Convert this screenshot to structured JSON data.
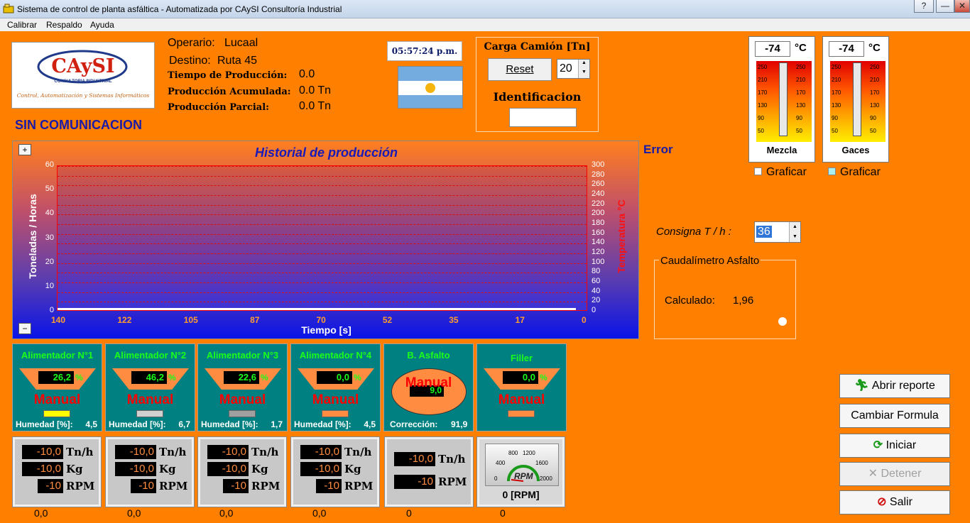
{
  "window": {
    "title": "Sistema de control de planta asfáltica - Automatizada por CAySI Consultoría Industrial",
    "buttons": [
      "?",
      "—",
      "✕"
    ]
  },
  "menu": [
    "Calibrar",
    "Respaldo",
    "Ayuda"
  ],
  "logo": {
    "brand": "CAySI",
    "sub": "CONSULTORIA INDUSTRIAL",
    "tagline": "Control, Automatización y Sistemas Informáticos"
  },
  "status": "SIN COMUNICACION",
  "info": {
    "operario_label": "Operario:",
    "operario": "Lucaal",
    "destino_label": "Destino:",
    "destino": "Ruta 45",
    "tiempo_label": "Tiempo de Producción:",
    "tiempo": "0.0",
    "acum_label": "Producción Acumulada:",
    "acum": "0.0 Tn",
    "parcial_label": "Producción Parcial:",
    "parcial": "0.0 Tn"
  },
  "clock": "05:57:24 p.m.",
  "carga": {
    "title": "Carga Camión [Tn]",
    "reset": "Reset",
    "value": "20",
    "ident_label": "Identificacion",
    "ident_value": ""
  },
  "chart_data": {
    "type": "line",
    "title": "Historial de producción",
    "xlabel": "Tiempo [s]",
    "ylabel": "Toneladas / Horas",
    "y2label": "Temperatura °C",
    "x_ticks": [
      "140",
      "122",
      "105",
      "87",
      "70",
      "52",
      "35",
      "17",
      "0"
    ],
    "y_ticks": [
      "60",
      "50",
      "40",
      "30",
      "20",
      "10",
      "0"
    ],
    "y2_ticks": [
      "300",
      "280",
      "260",
      "240",
      "220",
      "200",
      "180",
      "160",
      "140",
      "120",
      "100",
      "80",
      "60",
      "40",
      "20",
      "0"
    ],
    "ylim": [
      0,
      60
    ],
    "y2lim": [
      0,
      300
    ],
    "grid": true,
    "series": []
  },
  "chart_zoom": {
    "plus": "+",
    "minus": "−"
  },
  "error": "Error",
  "thermo": [
    {
      "value": "-74",
      "unit": "°C",
      "label": "Mezcla",
      "graf": "Graficar",
      "check_color": "#ffffff"
    },
    {
      "value": "-74",
      "unit": "°C",
      "label": "Gaces",
      "graf": "Graficar",
      "check_color": "#aaf0f0"
    }
  ],
  "thermo_scale": [
    "250",
    "210",
    "170",
    "130",
    "90",
    "50"
  ],
  "consigna": {
    "label": "Consigna T / h :",
    "value": "36"
  },
  "caudal": {
    "title": "Caudalímetro Asfalto",
    "calc_label": "Calculado:",
    "calc_value": "1,96"
  },
  "feeders": [
    {
      "name": "Alimentador N°1",
      "value": "26,2",
      "pct": "%",
      "mode": "Manual",
      "hum_label": "Humedad [%]:",
      "hum": "4,5",
      "bar": "#ffff00",
      "read": [
        "-10,0",
        "-10,0",
        "-10"
      ],
      "bottom": "0,0"
    },
    {
      "name": "Alimentador N°2",
      "value": "46,2",
      "pct": "%",
      "mode": "Manual",
      "hum_label": "Humedad [%]:",
      "hum": "6,7",
      "bar": "#d0d0d0",
      "read": [
        "-10,0",
        "-10,0",
        "-10"
      ],
      "bottom": "0,0"
    },
    {
      "name": "Alimentador N°3",
      "value": "22,6",
      "pct": "%",
      "mode": "Manual",
      "hum_label": "Humedad [%]:",
      "hum": "1,7",
      "bar": "#a0a0a0",
      "read": [
        "-10,0",
        "-10,0",
        "-10"
      ],
      "bottom": "0,0"
    },
    {
      "name": "Alimentador N°4",
      "value": "0,0",
      "pct": "%",
      "mode": "Manual",
      "hum_label": "Humedad [%]:",
      "hum": "4,5",
      "bar": "#ff8c40",
      "read": [
        "-10,0",
        "-10,0",
        "-10"
      ],
      "bottom": "0,0"
    }
  ],
  "asfalto": {
    "name": "B. Asfalto",
    "value": "9,0",
    "mode": "Manual",
    "corr_label": "Corrección:",
    "corr": "91,9",
    "read": [
      "-10,0",
      "-10"
    ],
    "bottom": "0"
  },
  "filler": {
    "name": "Filler",
    "value": "0,0",
    "pct": "%",
    "mode": "Manual",
    "bar": "#ff8c40",
    "rpm": "0 [RPM]",
    "bottom": "0",
    "gauge": [
      "800",
      "1200",
      "400",
      "1600",
      "0",
      "2000"
    ],
    "gauge_label": "RPM"
  },
  "units": {
    "tnh": "Tn/h",
    "kg": "Kg",
    "rpm": "RPM"
  },
  "actions": {
    "abrir": "Abrir reporte",
    "cambiar": "Cambiar Formula",
    "iniciar": "Iniciar",
    "detener": "Detener",
    "salir": "Salir"
  }
}
